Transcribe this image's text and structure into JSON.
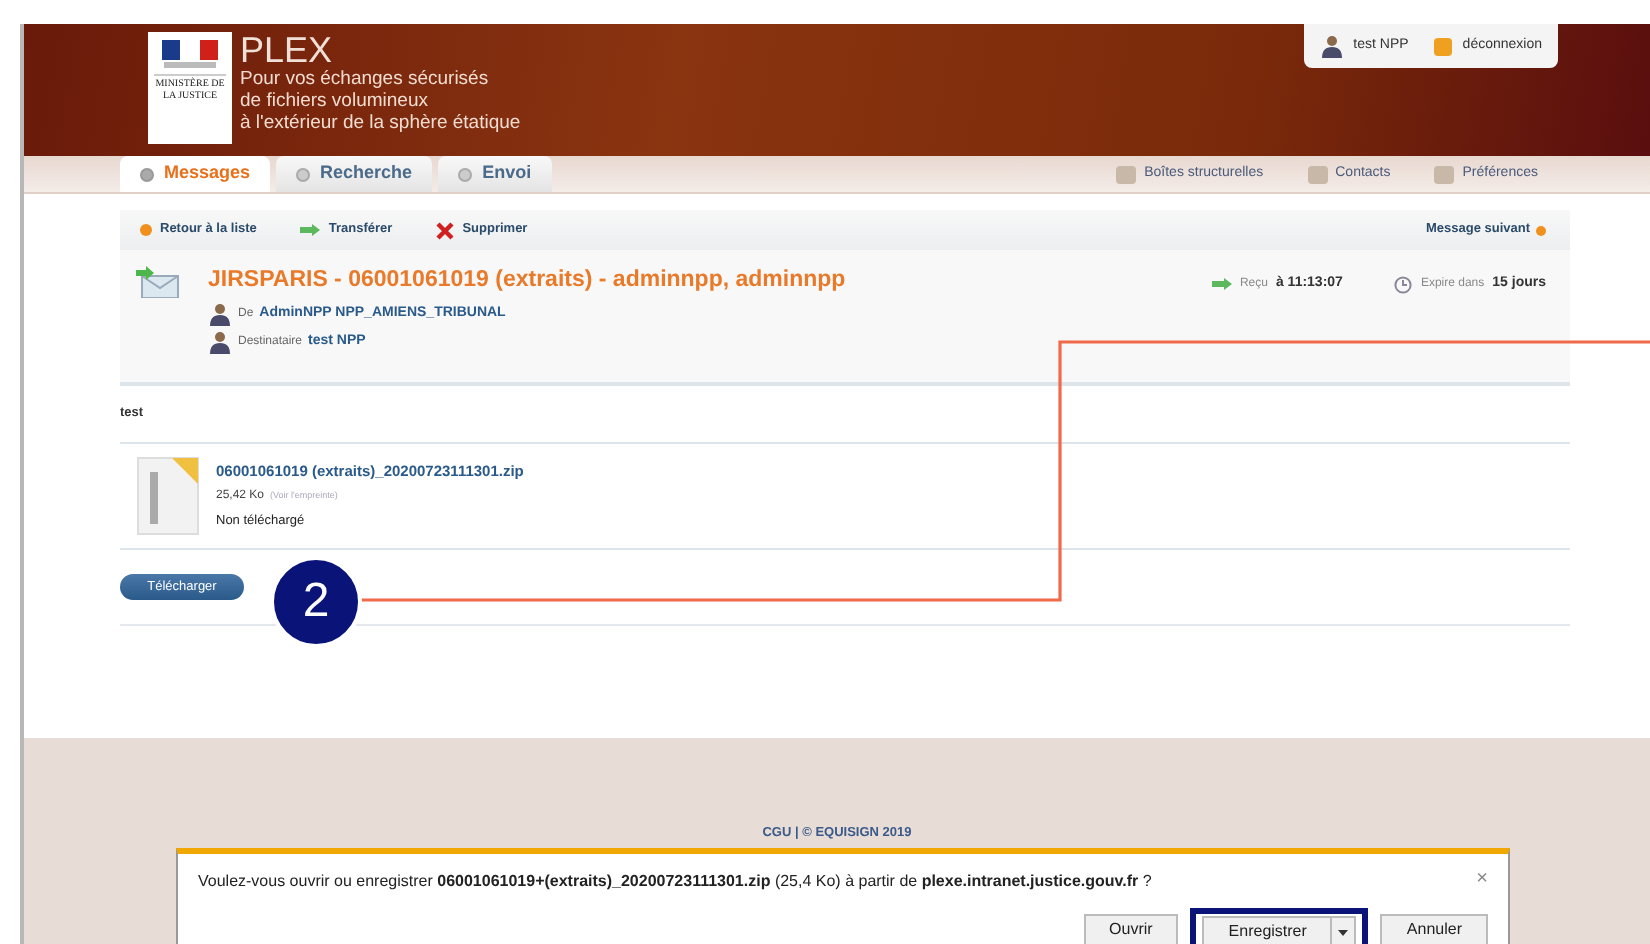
{
  "header": {
    "ministry": "MINISTÈRE DE LA JUSTICE",
    "app_name": "PLEX",
    "tagline": [
      "Pour vos échanges sécurisés",
      "de fichiers volumineux",
      "à l'extérieur de la sphère étatique"
    ],
    "user": "test NPP",
    "logout": "déconnexion"
  },
  "tabs": [
    {
      "label": "Messages",
      "selected": true
    },
    {
      "label": "Recherche",
      "selected": false
    },
    {
      "label": "Envoi",
      "selected": false
    }
  ],
  "nav_links": [
    "Boîtes structurelles",
    "Contacts",
    "Préférences"
  ],
  "toolbar": {
    "actions": [
      {
        "label": "Retour à la liste",
        "kind": "back"
      },
      {
        "label": "Transférer",
        "kind": "forward"
      },
      {
        "label": "Supprimer",
        "kind": "delete"
      }
    ],
    "next": "Message suivant"
  },
  "message": {
    "subject": "JIRSPARIS - 06001061019 (extraits) - adminnpp, adminnpp",
    "from_label": "De",
    "from": "AdminNPP NPP_AMIENS_TRIBUNAL",
    "to_label": "Destinataire",
    "to": "test NPP",
    "received_label": "Reçu",
    "received": "à 11:13:07",
    "expires_label": "Expire dans",
    "expires": "15 jours",
    "body": "test"
  },
  "attachment": {
    "name": "06001061019 (extraits)_20200723111301.zip",
    "size": "25,42 Ko",
    "fingerprint": "(Voir l'empreinte)",
    "status": "Non téléchargé"
  },
  "download_button": "Télécharger",
  "callout": "2",
  "footer": "CGU | © EQUISIGN 2019",
  "dialog": {
    "message": "Voulez-vous ouvrir ou enregistrer **06001061019+(extraits)_20200723111301.zip** (25,4 Ko) à partir de **plexe.intranet.justice.gouv.fr** ?",
    "close": "×",
    "buttons": [
      {
        "label": "Ouvrir",
        "highlighted": false,
        "split": false
      },
      {
        "label": "Enregistrer",
        "highlighted": true,
        "split": true
      },
      {
        "label": "Annuler",
        "highlighted": false,
        "split": false
      }
    ]
  }
}
